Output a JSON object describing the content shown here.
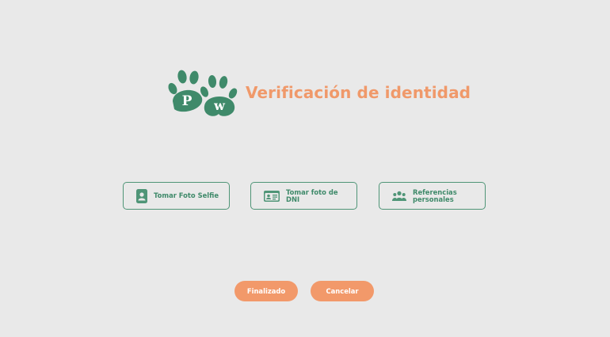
{
  "header": {
    "logo_text": "PW",
    "title": "Verificación de identidad"
  },
  "options": [
    {
      "label": "Tomar Foto Selfie",
      "icon": "person-badge-icon"
    },
    {
      "label": "Tomar foto de DNI",
      "icon": "id-card-icon"
    },
    {
      "label": "Referencias personales",
      "icon": "people-icon"
    }
  ],
  "actions": {
    "finish_label": "Finalizado",
    "cancel_label": "Cancelar"
  },
  "colors": {
    "background": "#e9e9e9",
    "brand_green": "#4f9577",
    "accent_orange": "#f2996a"
  }
}
